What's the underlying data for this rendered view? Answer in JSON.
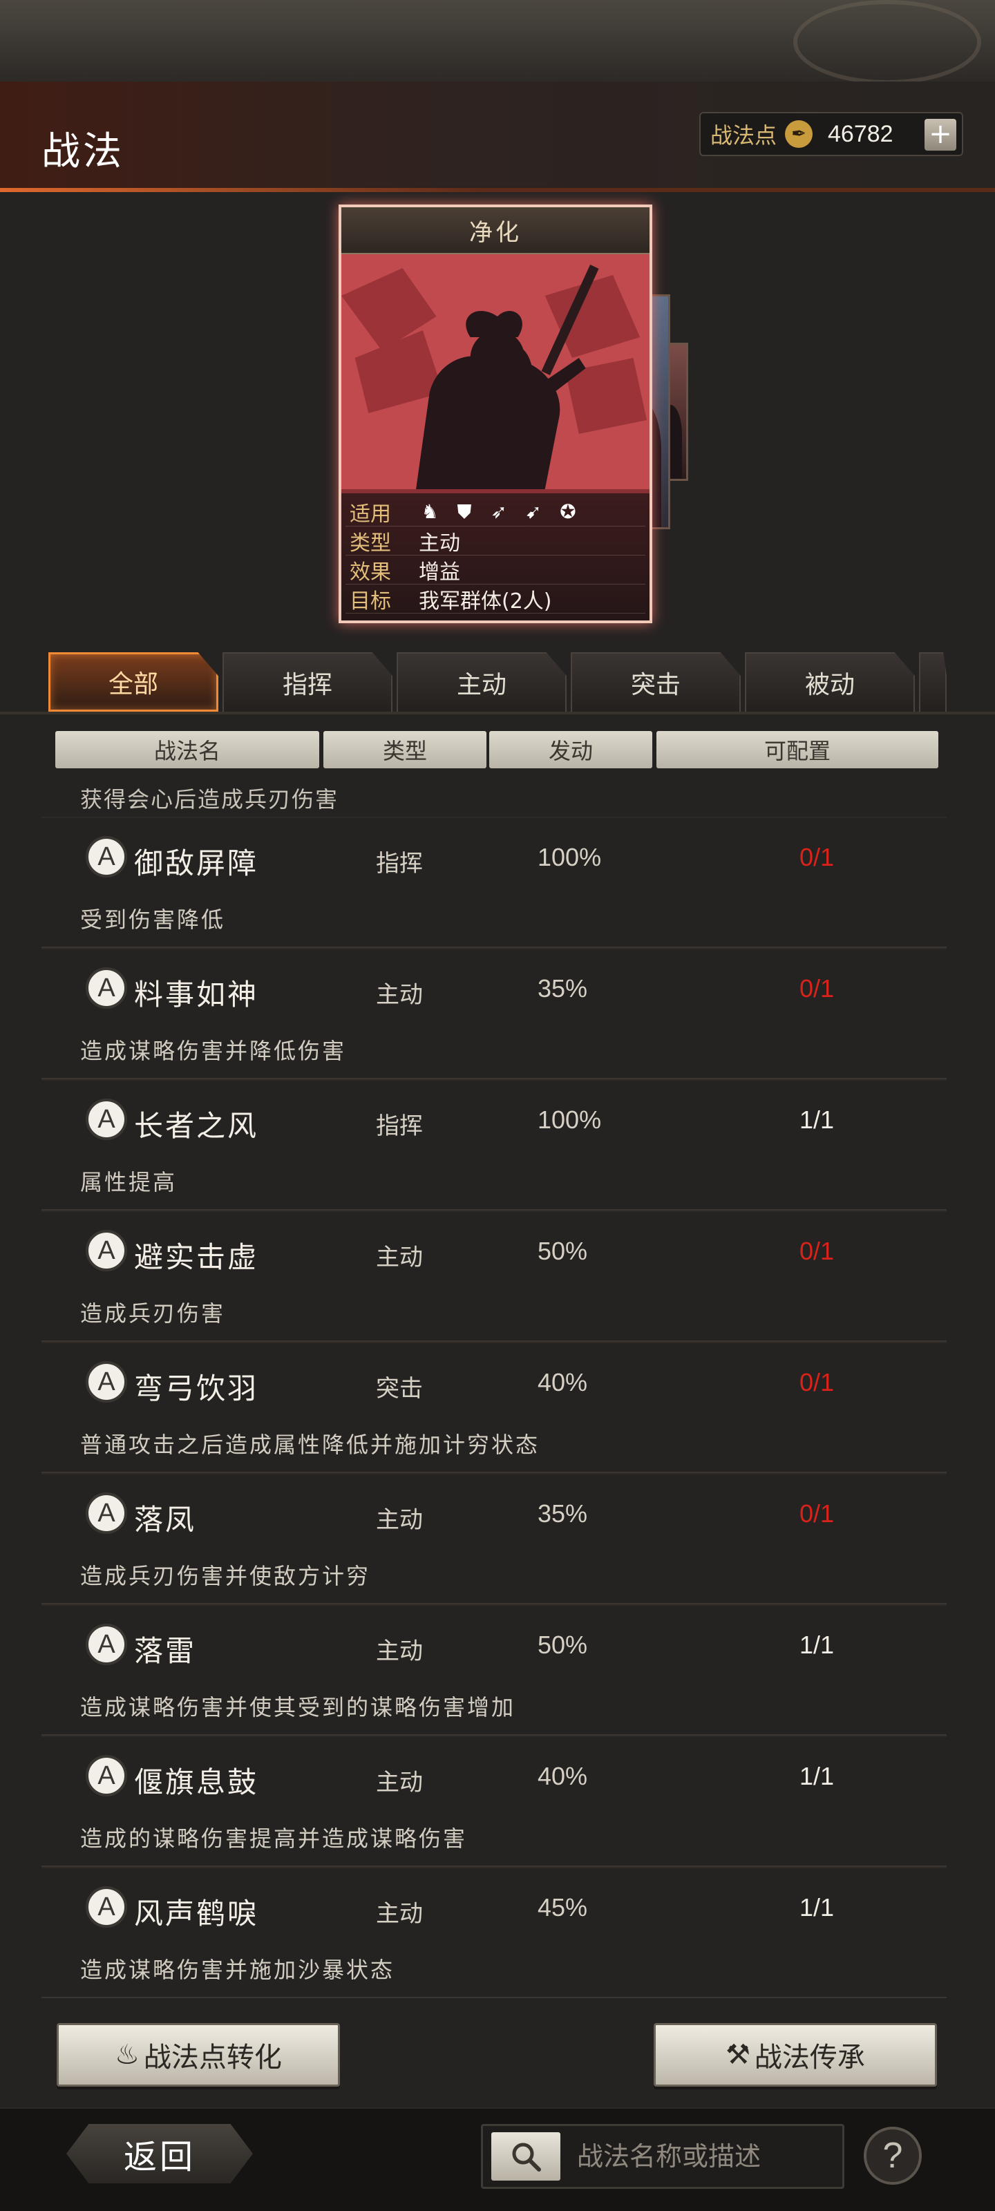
{
  "header": {
    "title": "战法",
    "points_label": "战法点",
    "points_value": "46782",
    "plus_label": "+"
  },
  "card": {
    "name": "净化",
    "stats": {
      "applicable_label": "适用",
      "type_label": "类型",
      "type_value": "主动",
      "effect_label": "效果",
      "effect_value": "增益",
      "target_label": "目标",
      "target_value": "我军群体(2人)"
    },
    "troop_icons": [
      "cavalry-icon",
      "shield-icon",
      "bow-icon",
      "spear-icon",
      "wheel-icon"
    ]
  },
  "tabs": [
    {
      "label": "全部",
      "active": true
    },
    {
      "label": "指挥",
      "active": false
    },
    {
      "label": "主动",
      "active": false
    },
    {
      "label": "突击",
      "active": false
    },
    {
      "label": "被动",
      "active": false
    }
  ],
  "columns": {
    "name": "战法名",
    "type": "类型",
    "rate": "发动",
    "available": "可配置"
  },
  "partial_desc": "获得会心后造成兵刃伤害",
  "skills": [
    {
      "badge": "A",
      "name": "御敌屏障",
      "type": "指挥",
      "rate": "100%",
      "available": "0/1",
      "desc": "受到伤害降低"
    },
    {
      "badge": "A",
      "name": "料事如神",
      "type": "主动",
      "rate": "35%",
      "available": "0/1",
      "desc": "造成谋略伤害并降低伤害"
    },
    {
      "badge": "A",
      "name": "长者之风",
      "type": "指挥",
      "rate": "100%",
      "available": "1/1",
      "desc": "属性提高"
    },
    {
      "badge": "A",
      "name": "避实击虚",
      "type": "主动",
      "rate": "50%",
      "available": "0/1",
      "desc": "造成兵刃伤害"
    },
    {
      "badge": "A",
      "name": "弯弓饮羽",
      "type": "突击",
      "rate": "40%",
      "available": "0/1",
      "desc": "普通攻击之后造成属性降低并施加计穷状态"
    },
    {
      "badge": "A",
      "name": "落凤",
      "type": "主动",
      "rate": "35%",
      "available": "0/1",
      "desc": "造成兵刃伤害并使敌方计穷"
    },
    {
      "badge": "A",
      "name": "落雷",
      "type": "主动",
      "rate": "50%",
      "available": "1/1",
      "desc": "造成谋略伤害并使其受到的谋略伤害增加"
    },
    {
      "badge": "A",
      "name": "偃旗息鼓",
      "type": "主动",
      "rate": "40%",
      "available": "1/1",
      "desc": "造成的谋略伤害提高并造成谋略伤害"
    },
    {
      "badge": "A",
      "name": "风声鹤唳",
      "type": "主动",
      "rate": "45%",
      "available": "1/1",
      "desc": "造成谋略伤害并施加沙暴状态"
    }
  ],
  "colors": {
    "unavailable": "#d8231b",
    "available": "#f2eee6",
    "accent": "#f08a35"
  },
  "buttons": {
    "convert": "战法点转化",
    "inherit": "战法传承"
  },
  "footer": {
    "back": "返回",
    "search_placeholder": "战法名称或描述",
    "help": "?"
  }
}
